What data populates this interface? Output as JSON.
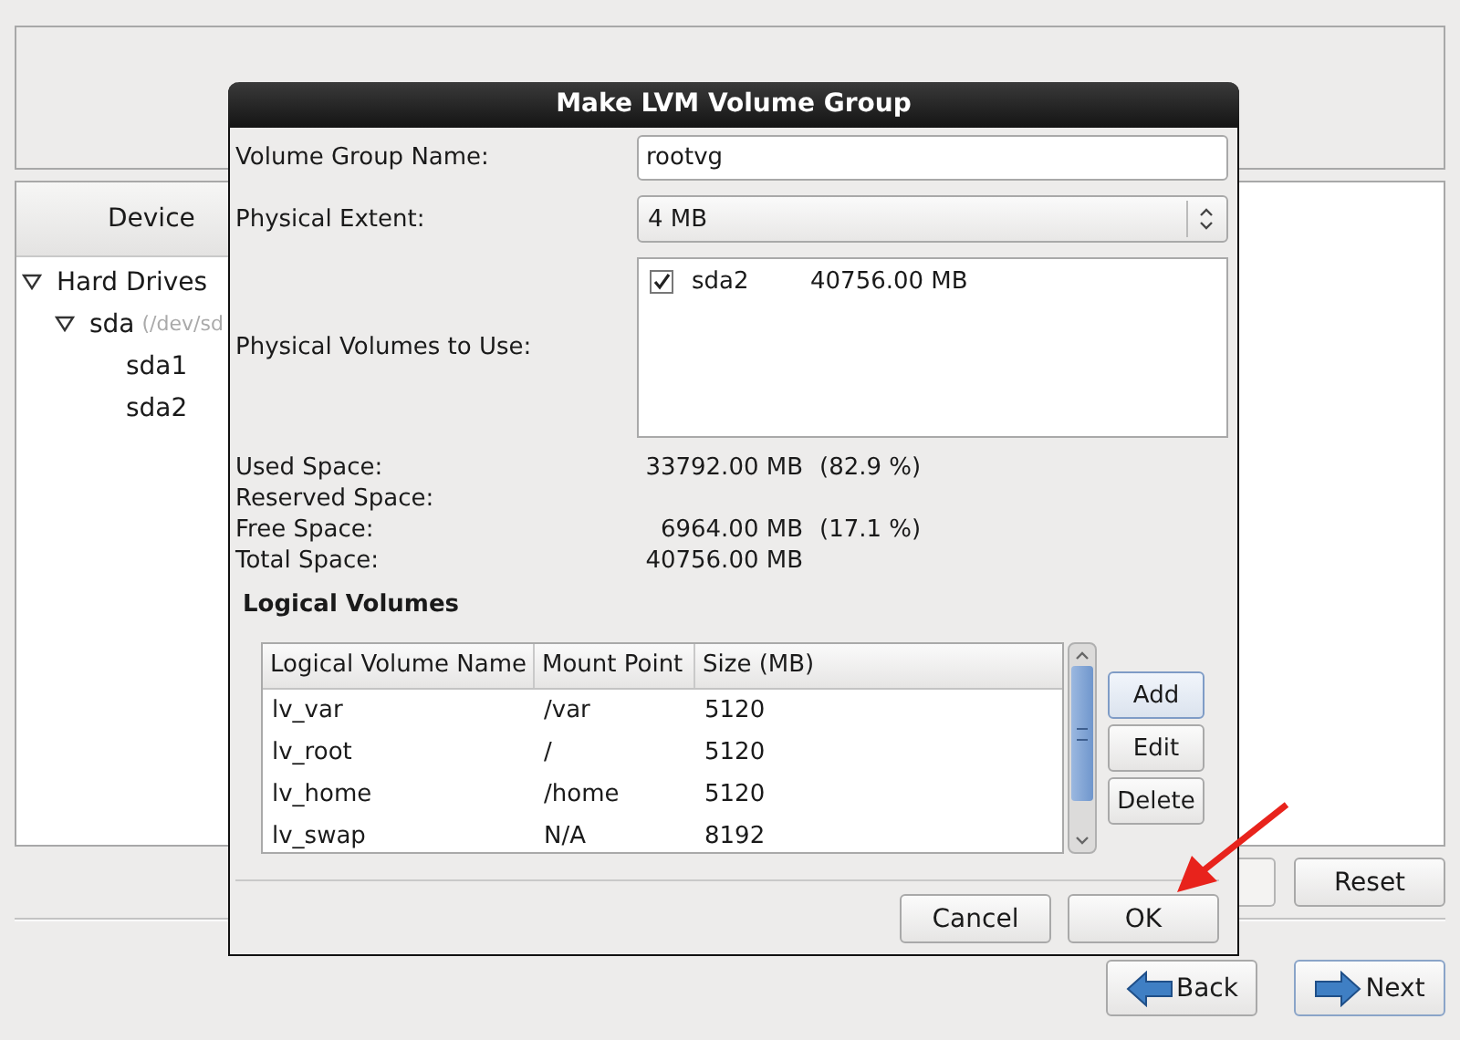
{
  "background": {
    "device_header": "Device",
    "tree": [
      {
        "label": "Hard Drives",
        "expanded": true,
        "children": [
          {
            "label": "sda",
            "detail": "(/dev/sd",
            "expanded": true,
            "children": [
              {
                "label": "sda1"
              },
              {
                "label": "sda2"
              }
            ]
          }
        ]
      }
    ],
    "reset_button": "Reset",
    "nav_buttons": [
      {
        "label": "Back",
        "kind": "back"
      },
      {
        "label": "Next",
        "kind": "next"
      }
    ]
  },
  "dialog": {
    "title": "Make LVM Volume Group",
    "name_label": "Volume Group Name:",
    "name_value": "rootvg",
    "extent_label": "Physical Extent:",
    "extent_value": "4 MB",
    "pv_label": "Physical Volumes to Use:",
    "physical_volumes": [
      {
        "name": "sda2",
        "size": "40756.00 MB",
        "checked": true
      }
    ],
    "stats": [
      {
        "label": "Used Space:",
        "value": "33792.00 MB",
        "percent": "(82.9 %)"
      },
      {
        "label": "Reserved Space:"
      },
      {
        "label": "Free Space:",
        "value": "6964.00 MB",
        "percent": "(17.1 %)"
      },
      {
        "label": "Total Space:",
        "value": "40756.00 MB"
      }
    ],
    "lv_heading": "Logical Volumes",
    "lv_table": {
      "columns": [
        "Logical Volume Name",
        "Mount Point",
        "Size (MB)"
      ],
      "rows": [
        [
          "lv_var",
          "/var",
          "5120"
        ],
        [
          "lv_root",
          "/",
          "5120"
        ],
        [
          "lv_home",
          "/home",
          "5120"
        ],
        [
          "lv_swap",
          "N/A",
          "8192"
        ]
      ]
    },
    "lv_buttons": [
      {
        "label": "Add",
        "focused": true
      },
      {
        "label": "Edit",
        "focused": false
      },
      {
        "label": "Delete",
        "focused": false
      }
    ],
    "footer_buttons": [
      "Cancel",
      "OK"
    ]
  }
}
